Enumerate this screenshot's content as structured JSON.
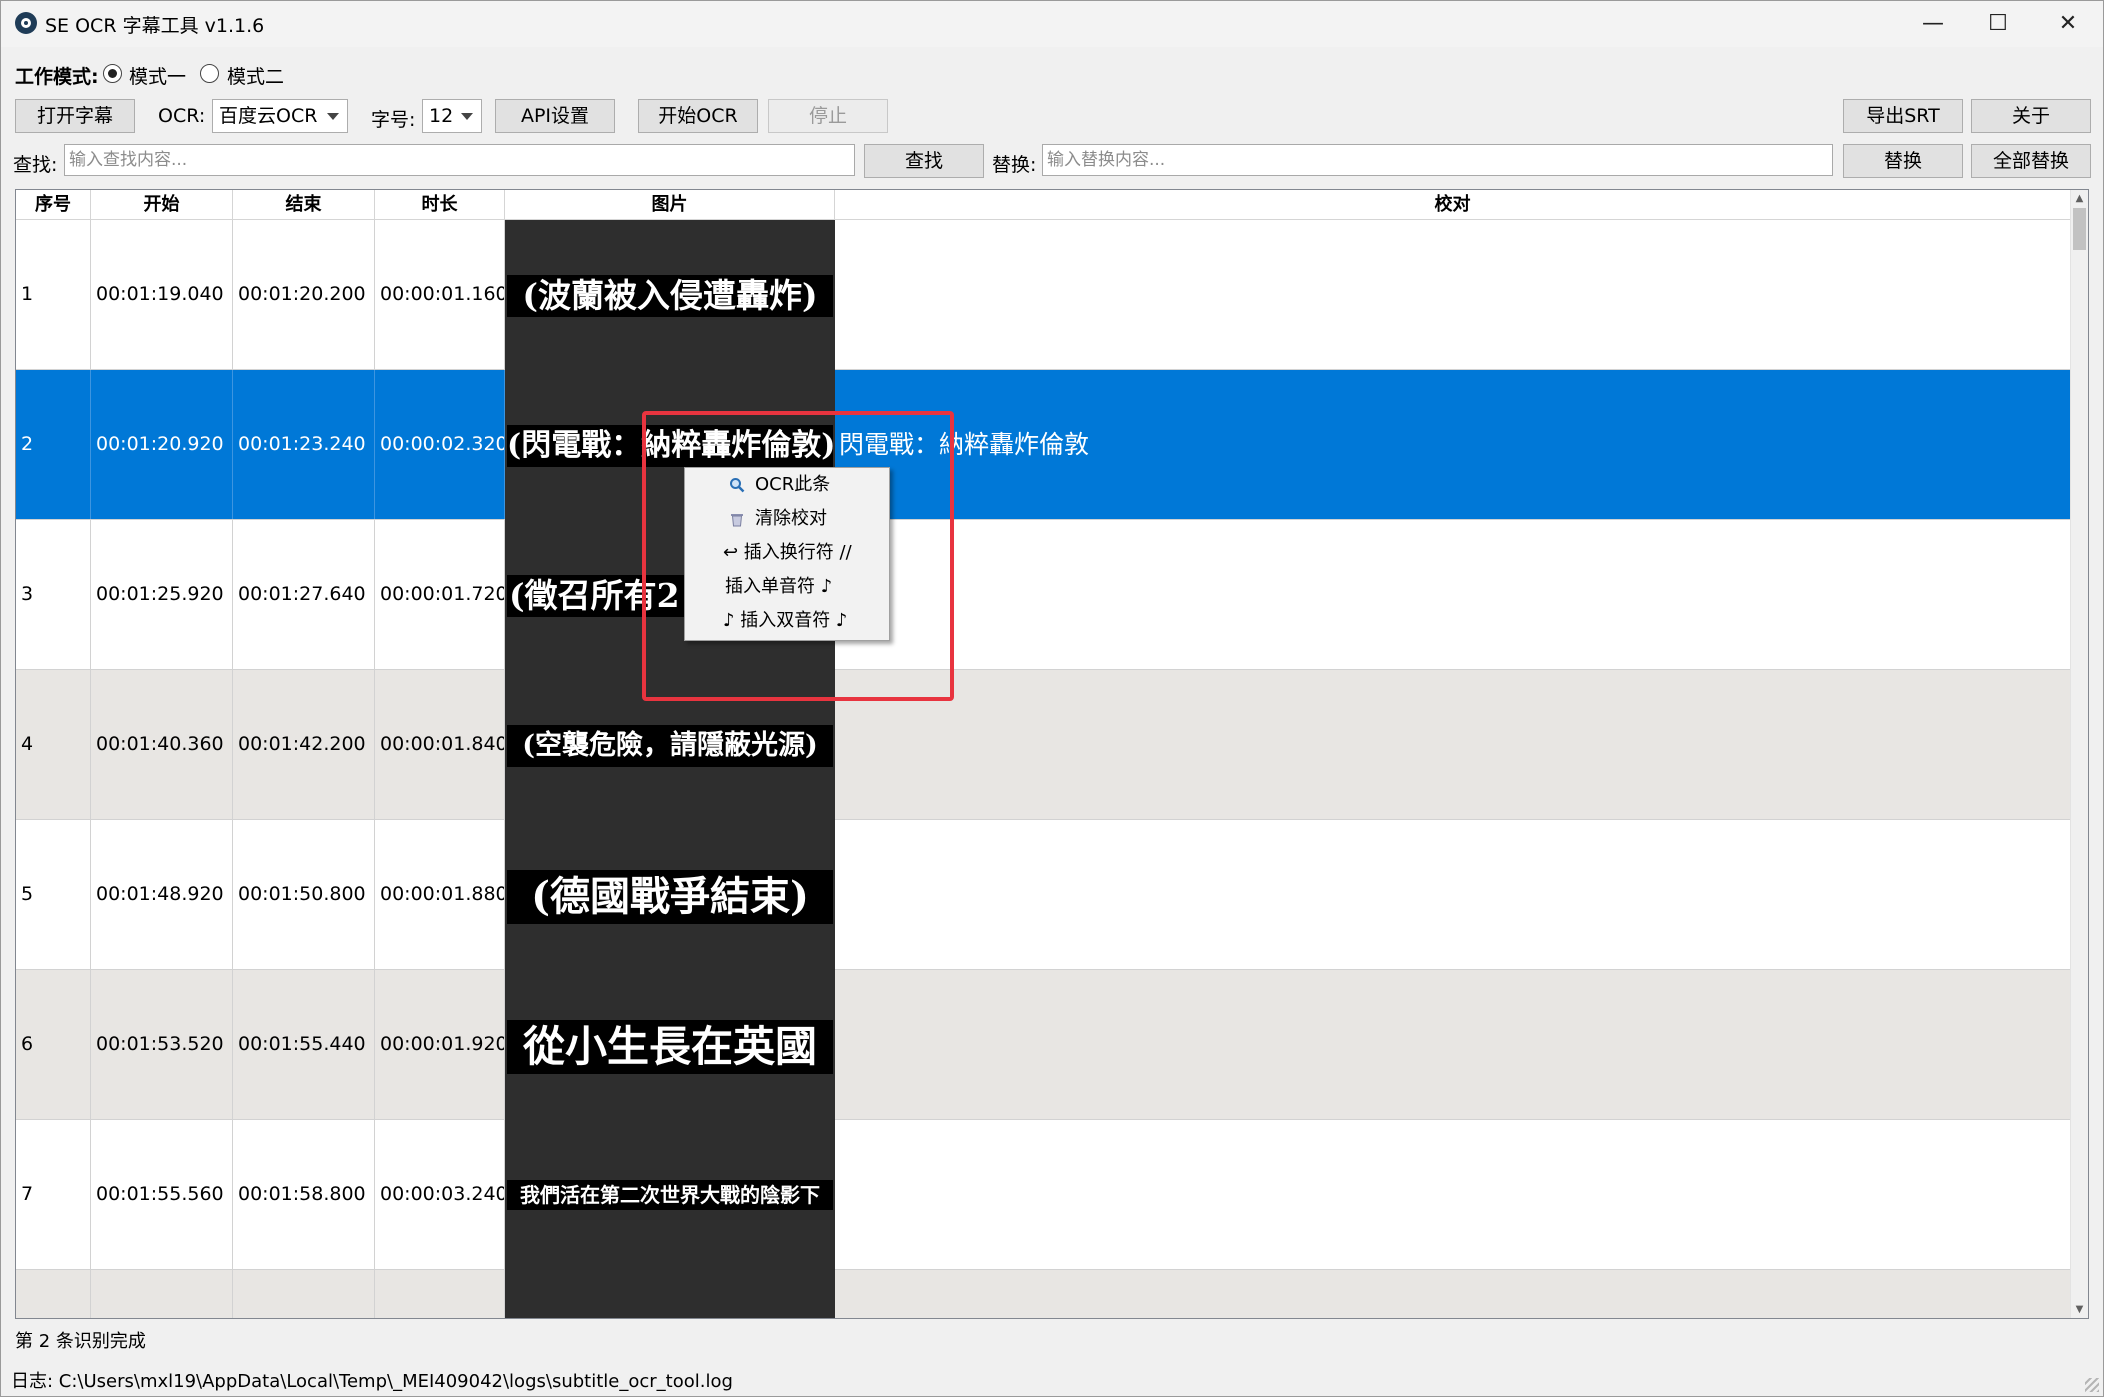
{
  "window": {
    "title": "SE OCR 字幕工具 v1.1.6",
    "minimize": "—",
    "maximize": "☐",
    "close": "✕"
  },
  "mode": {
    "label": "工作模式:",
    "option1": "模式一",
    "option2": "模式二",
    "selected": "模式一"
  },
  "toolbar": {
    "open": "打开字幕",
    "ocr_label": "OCR:",
    "ocr_value": "百度云OCR",
    "font_label": "字号:",
    "font_value": "12",
    "api": "API设置",
    "start": "开始OCR",
    "stop": "停止",
    "export": "导出SRT",
    "about": "关于"
  },
  "search": {
    "find_label": "查找:",
    "find_placeholder": "输入查找内容...",
    "find_button": "查找",
    "replace_label": "替换:",
    "replace_placeholder": "输入替换内容...",
    "replace_button": "替换",
    "replace_all_button": "全部替换"
  },
  "table": {
    "headers": [
      "序号",
      "开始",
      "结束",
      "时长",
      "图片",
      "校对"
    ],
    "rows": [
      {
        "no": "1",
        "start": "00:01:19.040",
        "end": "00:01:20.200",
        "dur": "00:00:01.160",
        "image_text": "(波蘭被入侵遭轟炸)",
        "proof": ""
      },
      {
        "no": "2",
        "start": "00:01:20.920",
        "end": "00:01:23.240",
        "dur": "00:00:02.320",
        "image_text": "(閃電戰：納粹轟炸倫敦)",
        "proof": "閃電戰：納粹轟炸倫敦"
      },
      {
        "no": "3",
        "start": "00:01:25.920",
        "end": "00:01:27.640",
        "dur": "00:00:01.720",
        "image_text": "(徵召所有2",
        "proof": ""
      },
      {
        "no": "4",
        "start": "00:01:40.360",
        "end": "00:01:42.200",
        "dur": "00:00:01.840",
        "image_text": "(空襲危險，請隱蔽光源)",
        "proof": ""
      },
      {
        "no": "5",
        "start": "00:01:48.920",
        "end": "00:01:50.800",
        "dur": "00:00:01.880",
        "image_text": "(德國戰爭結束)",
        "proof": ""
      },
      {
        "no": "6",
        "start": "00:01:53.520",
        "end": "00:01:55.440",
        "dur": "00:00:01.920",
        "image_text": "從小生長在英國",
        "proof": ""
      },
      {
        "no": "7",
        "start": "00:01:55.560",
        "end": "00:01:58.800",
        "dur": "00:00:03.240",
        "image_text": "我們活在第二次世界大戰的陰影下",
        "proof": ""
      }
    ],
    "selected_row": 2
  },
  "context_menu": {
    "items": [
      {
        "icon": "magnifier-icon",
        "label": "OCR此条"
      },
      {
        "icon": "trash-icon",
        "label": "清除校对"
      },
      {
        "icon": "return-arrow-icon",
        "label": "↩ 插入换行符 //"
      },
      {
        "icon": "",
        "label": "插入单音符 ♪"
      },
      {
        "icon": "",
        "label": "♪ 插入双音符 ♪"
      }
    ]
  },
  "status": {
    "message": "第 2 条识别完成",
    "log": "日志: C:\\Users\\mxl19\\AppData\\Local\\Temp\\_MEI409042\\logs\\subtitle_ocr_tool.log"
  },
  "colors": {
    "selection": "#0078d7",
    "highlight_box": "#e8343f",
    "alt_row": "#e8e6e3",
    "image_bg": "#2e2e2e"
  }
}
